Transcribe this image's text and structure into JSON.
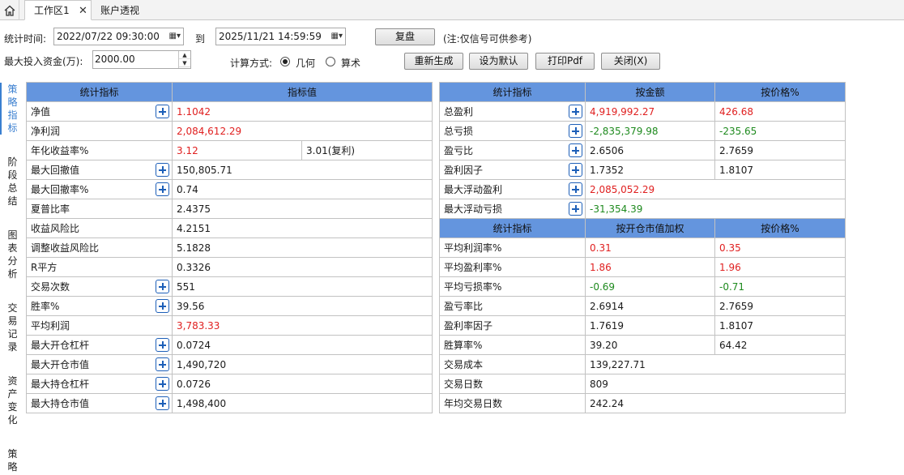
{
  "tabs": {
    "active": "工作区1",
    "close": "✕",
    "inactive": "账户透视"
  },
  "form": {
    "time_label": "统计时间:",
    "start": "2022/07/22 09:30:00",
    "to_label": "到",
    "end": "2025/11/21 14:59:59",
    "replay_button": "复盘",
    "note": "(注:仅信号可供参考)",
    "capital_label": "最大投入资金(万):",
    "capital_value": "2000.00",
    "calc_label": "计算方式:",
    "calc_geometric": "几何",
    "calc_arithmetic": "算术",
    "calc_selected": "几何",
    "regen_button": "重新生成",
    "default_button": "设为默认",
    "pdf_button": "打印Pdf",
    "close_button": "关闭(X)"
  },
  "vnav": {
    "items": [
      "策略指标",
      "阶段总结",
      "图表分析",
      "交易记录",
      "资产变化",
      "策略"
    ],
    "active": "策略指标"
  },
  "left_table": {
    "headers": [
      "统计指标",
      "指标值"
    ],
    "rows": [
      {
        "name": "净值",
        "value": "1.1042",
        "extra": "",
        "plus": true,
        "color": "red"
      },
      {
        "name": "净利润",
        "value": "2,084,612.29",
        "extra": "",
        "plus": false,
        "color": "red"
      },
      {
        "name": "年化收益率%",
        "value": "3.12",
        "extra": "3.01(复利)",
        "plus": false,
        "color": "red"
      },
      {
        "name": "最大回撤值",
        "value": "150,805.71",
        "extra": "",
        "plus": true,
        "color": ""
      },
      {
        "name": "最大回撤率%",
        "value": "0.74",
        "extra": "",
        "plus": true,
        "color": ""
      },
      {
        "name": "夏普比率",
        "value": "2.4375",
        "extra": "",
        "plus": false,
        "color": ""
      },
      {
        "name": "收益风险比",
        "value": "4.2151",
        "extra": "",
        "plus": false,
        "color": ""
      },
      {
        "name": "调整收益风险比",
        "value": "5.1828",
        "extra": "",
        "plus": false,
        "color": ""
      },
      {
        "name": "R平方",
        "value": "0.3326",
        "extra": "",
        "plus": false,
        "color": ""
      },
      {
        "name": "交易次数",
        "value": "551",
        "extra": "",
        "plus": true,
        "color": ""
      },
      {
        "name": "胜率%",
        "value": "39.56",
        "extra": "",
        "plus": true,
        "color": ""
      },
      {
        "name": "平均利润",
        "value": "3,783.33",
        "extra": "",
        "plus": false,
        "color": "red"
      },
      {
        "name": "最大开仓杠杆",
        "value": "0.0724",
        "extra": "",
        "plus": true,
        "color": ""
      },
      {
        "name": "最大开仓市值",
        "value": "1,490,720",
        "extra": "",
        "plus": true,
        "color": ""
      },
      {
        "name": "最大持仓杠杆",
        "value": "0.0726",
        "extra": "",
        "plus": true,
        "color": ""
      },
      {
        "name": "最大持仓市值",
        "value": "1,498,400",
        "extra": "",
        "plus": true,
        "color": ""
      }
    ]
  },
  "right_table": {
    "headers1": [
      "统计指标",
      "按金额",
      "按价格%"
    ],
    "rows1": [
      {
        "name": "总盈利",
        "a": "4,919,992.27",
        "b": "426.68",
        "plus": true,
        "color": "red"
      },
      {
        "name": "总亏损",
        "a": "-2,835,379.98",
        "b": "-235.65",
        "plus": true,
        "color": "green"
      },
      {
        "name": "盈亏比",
        "a": "2.6506",
        "b": "2.7659",
        "plus": true,
        "color": ""
      },
      {
        "name": "盈利因子",
        "a": "1.7352",
        "b": "1.8107",
        "plus": true,
        "color": ""
      },
      {
        "name": "最大浮动盈利",
        "a": "2,085,052.29",
        "b": "",
        "plus": true,
        "color": "red"
      },
      {
        "name": "最大浮动亏损",
        "a": "-31,354.39",
        "b": "",
        "plus": true,
        "color": "green"
      }
    ],
    "headers2": [
      "统计指标",
      "按开仓市值加权",
      "按价格%"
    ],
    "rows2": [
      {
        "name": "平均利润率%",
        "a": "0.31",
        "b": "0.35",
        "color": "red"
      },
      {
        "name": "平均盈利率%",
        "a": "1.86",
        "b": "1.96",
        "color": "red"
      },
      {
        "name": "平均亏损率%",
        "a": "-0.69",
        "b": "-0.71",
        "color": "green"
      },
      {
        "name": "盈亏率比",
        "a": "2.6914",
        "b": "2.7659",
        "color": ""
      },
      {
        "name": "盈利率因子",
        "a": "1.7619",
        "b": "1.8107",
        "color": ""
      },
      {
        "name": "胜算率%",
        "a": "39.20",
        "b": "64.42",
        "color": ""
      },
      {
        "name": "交易成本",
        "a": "139,227.71",
        "b": "",
        "color": ""
      },
      {
        "name": "交易日数",
        "a": "809",
        "b": "",
        "color": ""
      },
      {
        "name": "年均交易日数",
        "a": "242.24",
        "b": "",
        "color": ""
      }
    ]
  },
  "colors": {
    "header_bg": "#6495de",
    "red": "#e02020",
    "green": "#1e8a1e",
    "accent": "#3a7fd0"
  }
}
